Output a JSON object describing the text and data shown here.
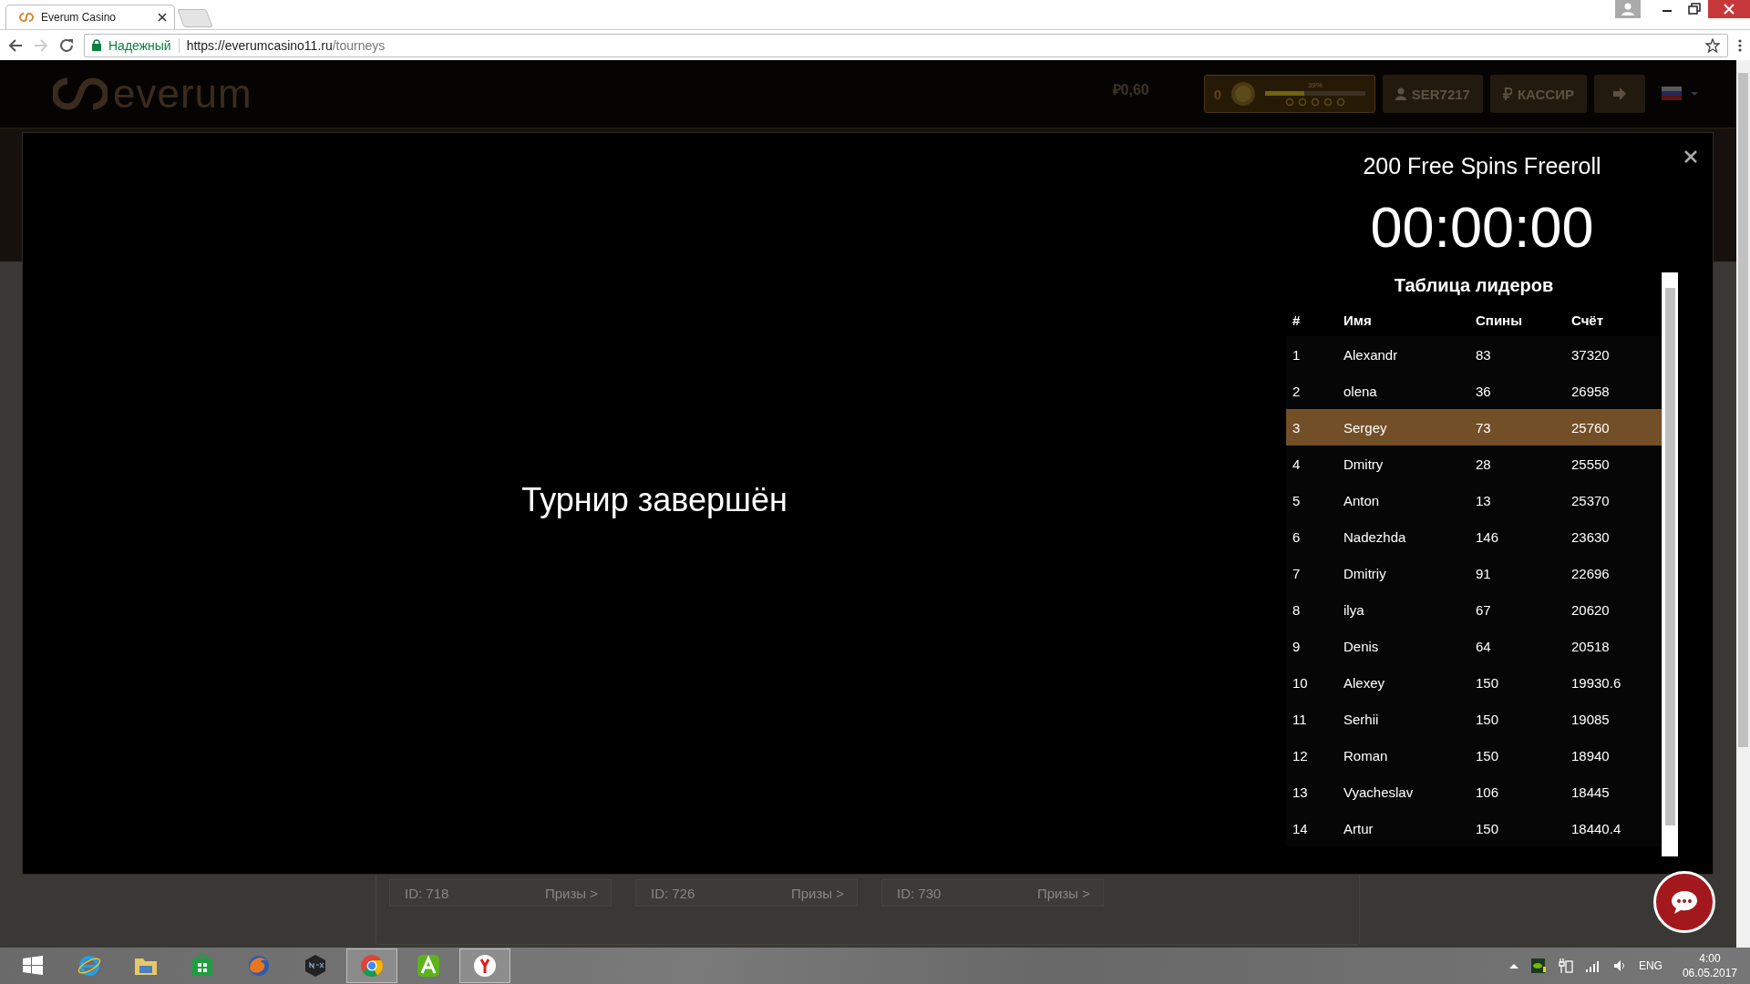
{
  "browser": {
    "tab_title": "Everum Casino",
    "security_label": "Надежный",
    "url_host": "https://everumcasino11.ru",
    "url_path": "/tourneys"
  },
  "header": {
    "logo": "everum",
    "balance": "₽0,60",
    "level": {
      "points": "0",
      "progress_label": "39%",
      "level": 0.39
    },
    "user_button": "SER7217",
    "cashier_button": "КАССИР"
  },
  "modal": {
    "status": "Турнир завершён",
    "title": "200 Free Spins Freeroll",
    "timer": "00:00:00",
    "leaderboard": {
      "title": "Таблица лидеров",
      "columns": [
        "#",
        "Имя",
        "Спины",
        "Счёт"
      ],
      "rows": [
        {
          "cells": [
            "1",
            "Alexandr",
            "83",
            "37320"
          ],
          "selected": false
        },
        {
          "cells": [
            "2",
            "olena",
            "36",
            "26958"
          ],
          "selected": false
        },
        {
          "cells": [
            "3",
            "Sergey",
            "73",
            "25760"
          ],
          "selected": true
        },
        {
          "cells": [
            "4",
            "Dmitry",
            "28",
            "25550"
          ],
          "selected": false
        },
        {
          "cells": [
            "5",
            "Anton",
            "13",
            "25370"
          ],
          "selected": false
        },
        {
          "cells": [
            "6",
            "Nadezhda",
            "146",
            "23630"
          ],
          "selected": false
        },
        {
          "cells": [
            "7",
            "Dmitriy",
            "91",
            "22696"
          ],
          "selected": false
        },
        {
          "cells": [
            "8",
            "ilya",
            "67",
            "20620"
          ],
          "selected": false
        },
        {
          "cells": [
            "9",
            "Denis",
            "64",
            "20518"
          ],
          "selected": false
        },
        {
          "cells": [
            "10",
            "Alexey",
            "150",
            "19930.6"
          ],
          "selected": false
        },
        {
          "cells": [
            "11",
            "Serhii",
            "150",
            "19085"
          ],
          "selected": false
        },
        {
          "cells": [
            "12",
            "Roman",
            "150",
            "18940"
          ],
          "selected": false
        },
        {
          "cells": [
            "13",
            "Vyacheslav",
            "106",
            "18445"
          ],
          "selected": false
        },
        {
          "cells": [
            "14",
            "Artur",
            "150",
            "18440.4"
          ],
          "selected": false
        }
      ]
    }
  },
  "tourney_cards": [
    {
      "id": "ID: 718",
      "prizes": "Призы >"
    },
    {
      "id": "ID: 726",
      "prizes": "Призы >"
    },
    {
      "id": "ID: 730",
      "prizes": "Призы >"
    }
  ],
  "taskbar": {
    "language": "ENG",
    "time": "4:00",
    "date": "06.05.2017"
  }
}
